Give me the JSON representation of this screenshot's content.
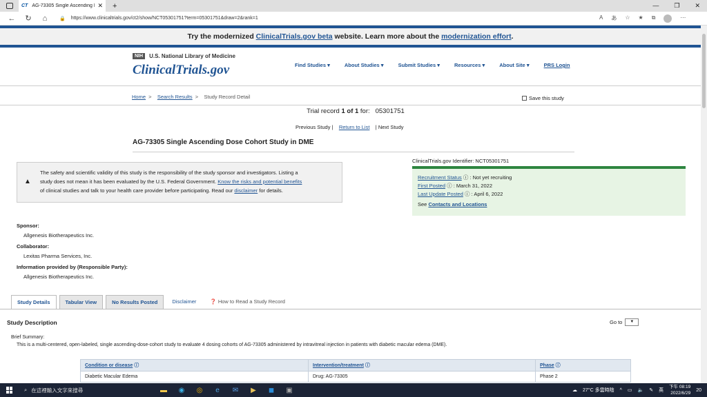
{
  "browser": {
    "tab_title": "AG-73305 Single Ascending Dos",
    "tab_favicon": "CT",
    "url": "https://www.clinicaltrials.gov/ct2/show/NCT05301751?term=05301751&draw=2&rank=1"
  },
  "banner": {
    "prefix": "Try the modernized ",
    "link1": "ClinicalTrials.gov beta",
    "middle": " website. Learn more about the ",
    "link2": "modernization effort",
    "suffix": "."
  },
  "header": {
    "nih_badge": "NIH",
    "nih_text": "U.S. National Library of Medicine",
    "logo": "ClinicalTrials.gov",
    "nav": [
      "Find Studies",
      "About Studies",
      "Submit Studies",
      "Resources",
      "About Site"
    ],
    "prs": "PRS Login"
  },
  "breadcrumb": {
    "home": "Home",
    "search": "Search Results",
    "current": "Study Record Detail"
  },
  "save_label": "Save this study",
  "trial": {
    "prefix": "Trial record ",
    "num": "1 of 1",
    "for": " for:",
    "term": "05301751"
  },
  "pager": {
    "prev": "Previous Study |",
    "return": "Return to List",
    "next": "| Next Study"
  },
  "study_title": "AG-73305 Single Ascending Dose Cohort Study in DME",
  "warning": {
    "line1": "The safety and scientific validity of this study is the responsibility of the study sponsor and investigators. Listing a",
    "line2": "study does not mean it has been evaluated by the U.S. Federal Government. ",
    "link1": "Know the risks and potential benefits",
    "line3": "of clinical studies and talk to your health care provider before participating. Read our ",
    "link2": "disclaimer",
    "line3b": " for details."
  },
  "identifier": "ClinicalTrials.gov Identifier: NCT05301751",
  "status": {
    "recruitment_label": "Recruitment Status",
    "recruitment_value": ": Not yet recruiting",
    "first_label": "First Posted",
    "first_value": ": March 31, 2022",
    "last_label": "Last Update Posted",
    "last_value": ": April 6, 2022",
    "see": "See ",
    "contacts": "Contacts and Locations"
  },
  "sponsor": {
    "label": "Sponsor:",
    "value": "Allgenesis Biotherapeutics Inc."
  },
  "collaborator": {
    "label": "Collaborator:",
    "value": "Lexitas Pharma Services, Inc."
  },
  "provider": {
    "label": "Information provided by (Responsible Party):",
    "value": "Allgenesis Biotherapeutics Inc."
  },
  "tabs": {
    "details": "Study Details",
    "tabular": "Tabular View",
    "results": "No Results Posted",
    "disclaimer": "Disclaimer",
    "how": "How to Read a Study Record"
  },
  "desc": {
    "title": "Study Description",
    "goto": "Go to",
    "brief_label": "Brief Summary:",
    "brief_text": "This is a multi-centered, open-labeled, single ascending-dose-cohort study to evaluate 4 dosing cohorts of AG-73305 administered by intravitreal injection in patients with diabetic macular edema (DME)."
  },
  "table": {
    "headers": [
      "Condition or disease",
      "Intervention/treatment",
      "Phase"
    ],
    "row": [
      "Diabetic Macular Edema",
      "Drug: AG-73305",
      "Phase 2"
    ]
  },
  "taskbar": {
    "search_placeholder": "在這裡輸入文字來搜尋",
    "weather": "27°C 多雲時陰",
    "ime": "英",
    "time": "下午 08:19",
    "date": "2022/6/29",
    "notif": "20"
  }
}
